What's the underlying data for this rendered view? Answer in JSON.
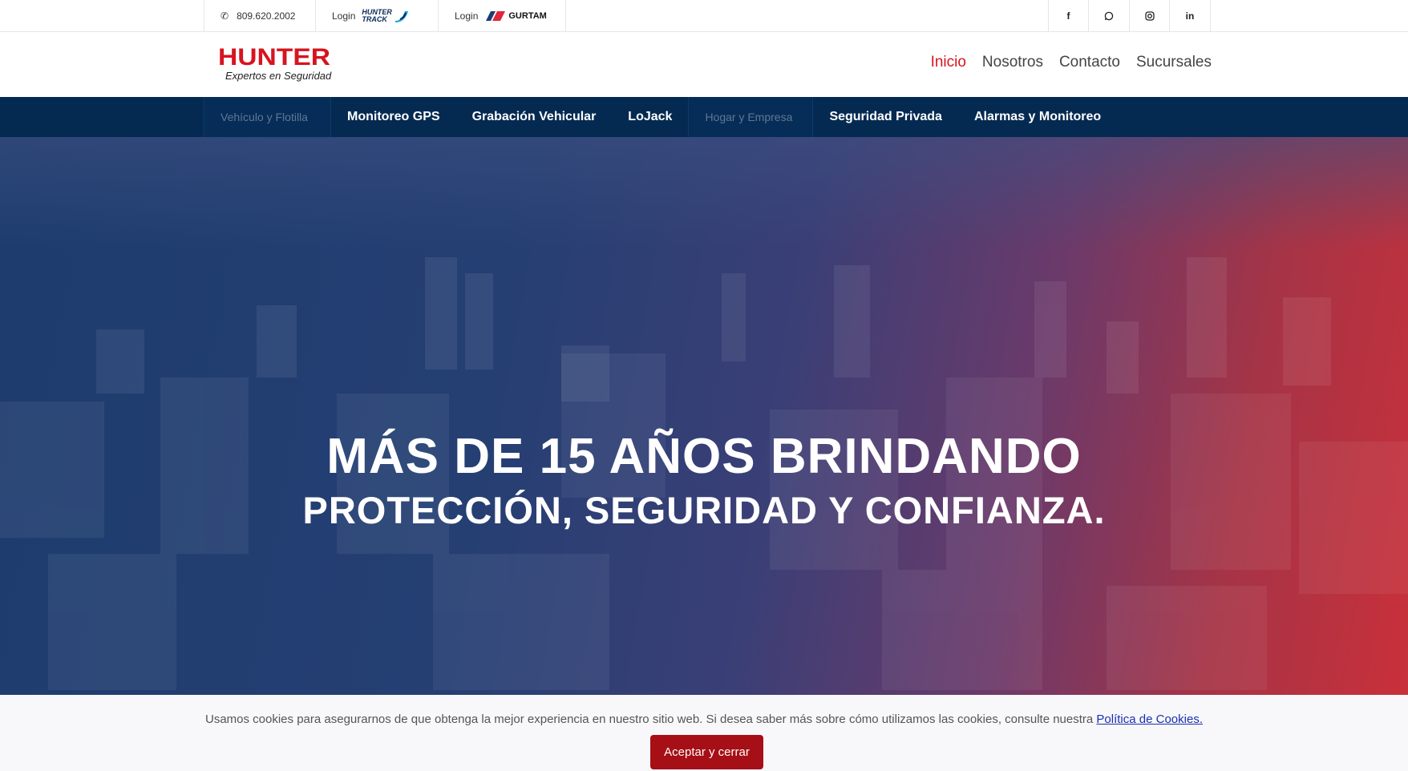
{
  "topbar": {
    "phone_icon": "phone-icon",
    "phone": "809.620.2002",
    "login1_label": "Login",
    "login1_brand_top": "HUNTER",
    "login1_brand_bottom": "TRACK",
    "login2_label": "Login",
    "login2_brand": "GURTAM",
    "social": [
      {
        "name": "facebook-icon",
        "glyph": "f"
      },
      {
        "name": "whatsapp-icon",
        "glyph": "◎"
      },
      {
        "name": "instagram-icon",
        "glyph": "◙"
      },
      {
        "name": "linkedin-icon",
        "glyph": "in"
      }
    ]
  },
  "header": {
    "logo_word": "HUNTER",
    "logo_tagline": "Expertos en Seguridad",
    "nav": [
      {
        "label": "Inicio",
        "active": true
      },
      {
        "label": "Nosotros",
        "active": false
      },
      {
        "label": "Contacto",
        "active": false
      },
      {
        "label": "Sucursales",
        "active": false
      }
    ]
  },
  "catbar": {
    "group1": "Vehículo y Flotilla",
    "items1": [
      "Monitoreo GPS",
      "Grabación Vehicular",
      "LoJack"
    ],
    "group2": "Hogar y Empresa",
    "items2": [
      "Seguridad Privada",
      "Alarmas y Monitoreo"
    ]
  },
  "hero": {
    "line1": "MÁS DE 15 AÑOS BRINDANDO",
    "line2": "PROTECCIÓN, SEGURIDAD Y CONFIANZA."
  },
  "cookie": {
    "message": "Usamos cookies para asegurarnos de que obtenga la mejor experiencia en nuestro sitio web. Si desea saber más sobre cómo utilizamos las cookies, consulte nuestra",
    "link": "Política de Cookies.",
    "button": "Aceptar y cerrar"
  },
  "colors": {
    "brand_red": "#d6141f",
    "nav_blue": "#052a52",
    "cookie_button": "#a50f15",
    "link_blue": "#1a2fb0"
  }
}
